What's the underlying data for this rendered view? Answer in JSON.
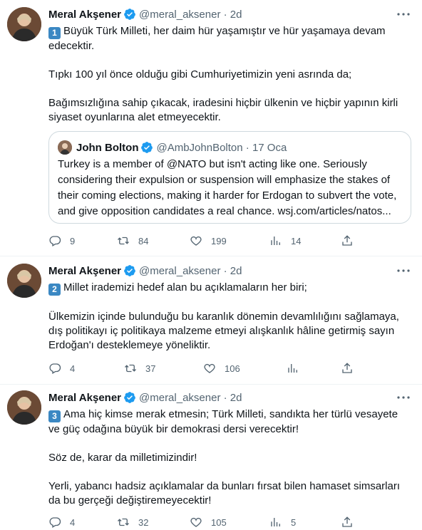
{
  "tweets": [
    {
      "name": "Meral Akşener",
      "handle": "@meral_aksener · 2d",
      "number": "1",
      "lines": [
        "Büyük Türk Milleti, her daim hür yaşamıştır ve hür yaşamaya devam edecektir.",
        "",
        "Tıpkı 100 yıl önce olduğu gibi Cumhuriyetimizin yeni asrında da;",
        "",
        "Bağımsızlığına sahip çıkacak, iradesini hiçbir ülkenin ve hiçbir yapının kirli siyaset oyunlarına alet etmeyecektir."
      ],
      "quote": {
        "name": "John Bolton",
        "handle": "@AmbJohnBolton · 17 Oca",
        "text": "Turkey is a member of @NATO but isn't acting like one. Seriously considering their expulsion or suspension will emphasize the stakes of their coming elections, making it harder for Erdogan to subvert the vote, and give opposition candidates a real chance. wsj.com/articles/natos..."
      },
      "replies": "9",
      "retweets": "84",
      "likes": "199",
      "views": "14"
    },
    {
      "name": "Meral Akşener",
      "handle": "@meral_aksener · 2d",
      "number": "2",
      "lines": [
        "Millet irademizi hedef alan bu açıklamaların her biri;",
        "",
        "Ülkemizin içinde bulunduğu bu karanlık dönemin devamlılığını sağlamaya, dış politikayı iç politikaya malzeme etmeyi alışkanlık hâline getirmiş sayın Erdoğan'ı desteklemeye yöneliktir."
      ],
      "replies": "4",
      "retweets": "37",
      "likes": "106",
      "views": ""
    },
    {
      "name": "Meral Akşener",
      "handle": "@meral_aksener · 2d",
      "number": "3",
      "lines": [
        "Ama hiç kimse merak etmesin; Türk Milleti, sandıkta her türlü vesayete ve güç odağına büyük bir demokrasi dersi verecektir!",
        "",
        "Söz de, karar da milletimizindir!",
        "",
        "Yerli, yabancı hadsiz açıklamalar da bunları fırsat bilen hamaset simsarları da bu gerçeği değiştiremeyecektir!"
      ],
      "replies": "4",
      "retweets": "32",
      "likes": "105",
      "views": "5"
    }
  ],
  "colors": {
    "accent": "#1d9bf0",
    "muted": "#536471",
    "border": "#cfd9de",
    "keycap": "#3b88c3"
  }
}
